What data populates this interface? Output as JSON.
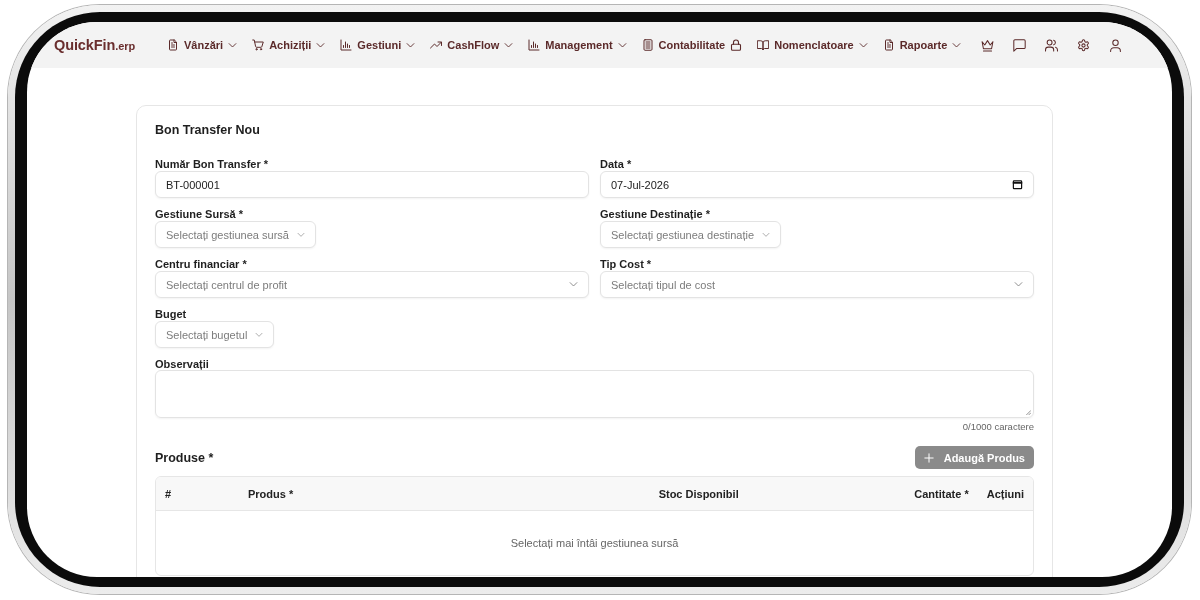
{
  "brand": {
    "name": "QuickFin",
    "suffix": ".erp"
  },
  "nav": [
    {
      "label": "Vânzări",
      "kind": "dropdown"
    },
    {
      "label": "Achiziții",
      "kind": "dropdown"
    },
    {
      "label": "Gestiuni",
      "kind": "dropdown"
    },
    {
      "label": "CashFlow",
      "kind": "dropdown"
    },
    {
      "label": "Management",
      "kind": "dropdown"
    },
    {
      "label": "Contabilitate",
      "kind": "locked"
    },
    {
      "label": "Nomenclatoare",
      "kind": "dropdown"
    },
    {
      "label": "Rapoarte",
      "kind": "dropdown"
    }
  ],
  "form": {
    "title": "Bon Transfer Nou",
    "fields": [
      {
        "label": "Număr Bon Transfer *",
        "kind": "text",
        "value": "BT-000001"
      },
      {
        "label": "Data *",
        "kind": "date",
        "value": "07-Jul-2026"
      },
      {
        "label": "Gestiune Sursă *",
        "kind": "compact",
        "placeholder": "Selectați gestiunea sursă"
      },
      {
        "label": "Gestiune Destinație *",
        "kind": "compact",
        "placeholder": "Selectați gestiunea destinație"
      },
      {
        "label": "Centru financiar *",
        "kind": "select",
        "placeholder": "Selectați centrul de profit"
      },
      {
        "label": "Tip Cost *",
        "kind": "select",
        "placeholder": "Selectați tipul de cost"
      },
      {
        "label": "Buget",
        "kind": "compact",
        "placeholder": "Selectați bugetul"
      },
      {
        "label": "Observații",
        "kind": "textarea",
        "counter": "0/1000 caractere"
      }
    ]
  },
  "products": {
    "title": "Produse *",
    "add_button": {
      "label": "Adaugă Produs",
      "disabled": true
    },
    "columns": [
      "#",
      "Produs *",
      "Stoc Disponibil",
      "Cantitate *",
      "Acțiuni"
    ],
    "empty_message": "Selectați mai întâi gestiunea sursă"
  }
}
